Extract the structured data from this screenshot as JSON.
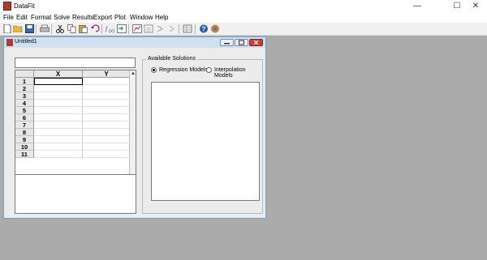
{
  "app": {
    "title": "DataFit"
  },
  "window_controls": {
    "minimize": "—",
    "maximize": "☐",
    "close": "✕"
  },
  "menu": [
    "File",
    "Edit",
    "Format",
    "Solve",
    "Results",
    "Export",
    "Plot",
    "Window",
    "Help"
  ],
  "toolbar": {
    "icons": [
      "new-file-icon",
      "open-folder-icon",
      "save-icon",
      "print-icon",
      "cut-icon",
      "copy-icon",
      "paste-icon",
      "undo-icon",
      "regression-icon",
      "solve-icon",
      "plot-icon",
      "results-icon",
      "export-icon",
      "next-icon",
      "sheet-icon",
      "help-icon",
      "about-icon"
    ]
  },
  "document": {
    "title": "Untitled1",
    "grid": {
      "columns": [
        "X",
        "Y"
      ],
      "rows": [
        "1",
        "2",
        "3",
        "4",
        "5",
        "6",
        "7",
        "8",
        "9",
        "10",
        "11"
      ]
    },
    "solutions": {
      "title": "Available Solutions",
      "options": [
        "Regression Models",
        "Interpolation Models"
      ],
      "selected": "Regression Models"
    }
  }
}
